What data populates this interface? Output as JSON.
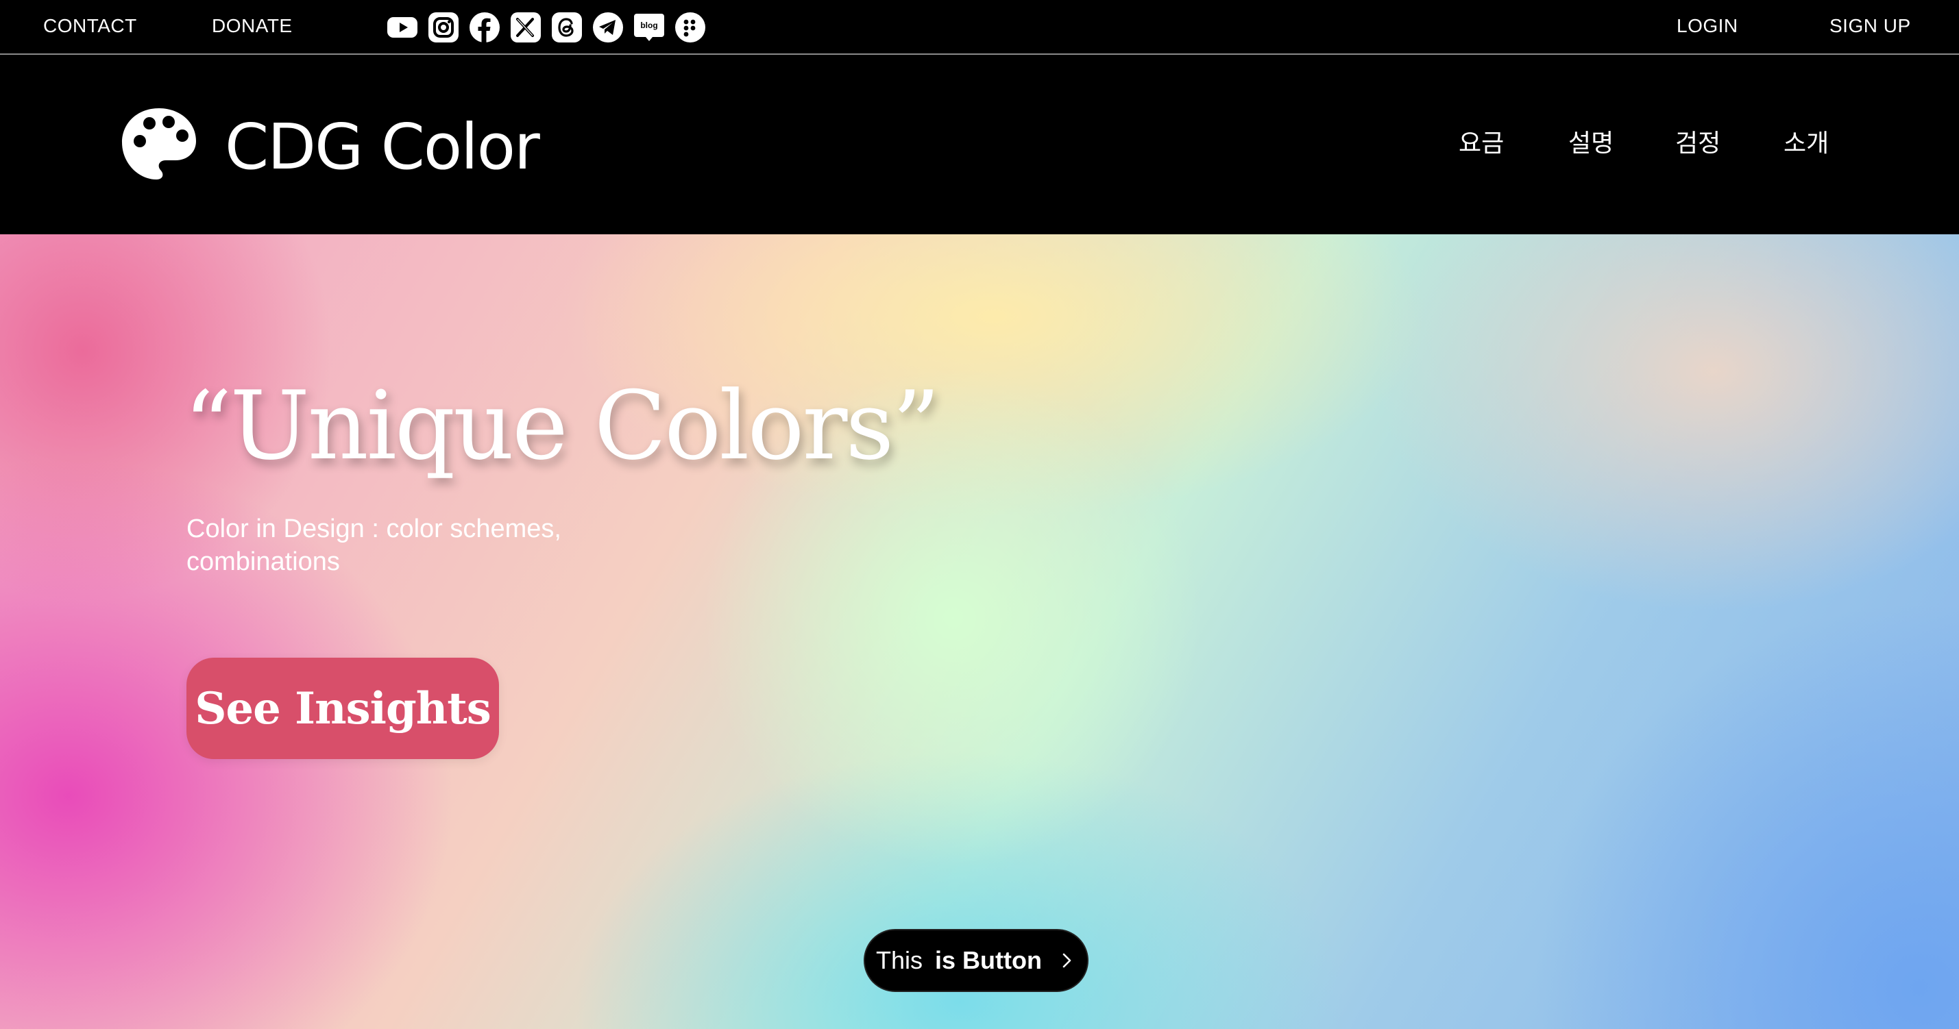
{
  "topbar": {
    "contact": "CONTACT",
    "donate": "DONATE",
    "login": "LOGIN",
    "signup": "SIGN UP",
    "social_icons": [
      "youtube-icon",
      "instagram-icon",
      "facebook-icon",
      "x-icon",
      "threads-icon",
      "telegram-icon",
      "blog-icon",
      "more-dots-icon"
    ],
    "blog_icon_text": "blog"
  },
  "header": {
    "logo_text": "CDG Color",
    "logo_icon": "palette-icon",
    "nav": [
      "요금",
      "설명",
      "검정",
      "소개"
    ]
  },
  "hero": {
    "title": "“Unique Colors”",
    "subtitle": "Color in Design : color schemes, combinations",
    "cta_label": "See Insights",
    "cta_color": "#d84f6a",
    "pill_prefix": "This ",
    "pill_bold": "is Button",
    "pill_icon": "chevron-right-icon"
  },
  "colors": {
    "bar_bg": "#000000",
    "text": "#ffffff",
    "divider": "#8a8a8a"
  }
}
